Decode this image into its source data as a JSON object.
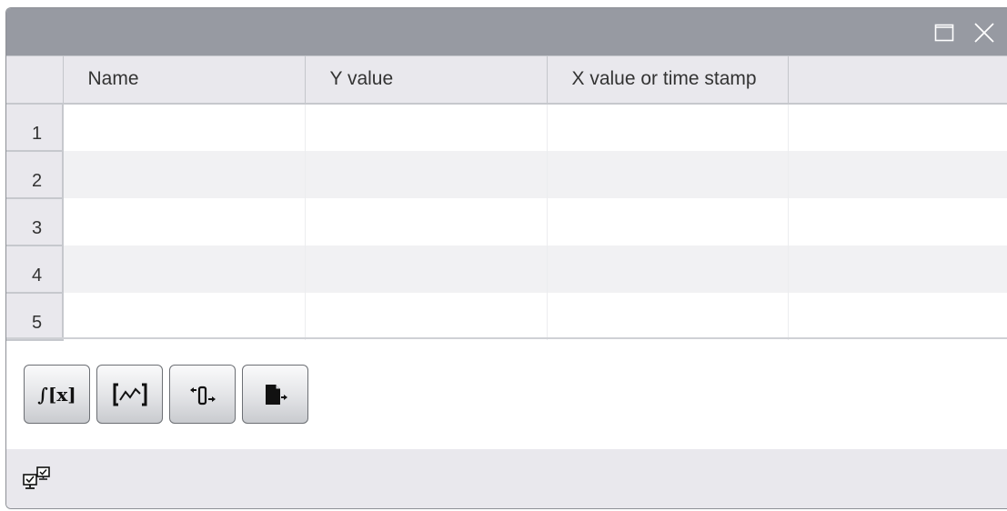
{
  "window": {
    "controls": [
      {
        "name": "maximize-icon"
      },
      {
        "name": "close-icon"
      }
    ]
  },
  "table": {
    "columns": [
      "",
      "Name",
      "Y value",
      "X value or time stamp",
      ""
    ],
    "rows": [
      {
        "num": "1",
        "name": "",
        "y": "",
        "x": ""
      },
      {
        "num": "2",
        "name": "",
        "y": "",
        "x": ""
      },
      {
        "num": "3",
        "name": "",
        "y": "",
        "x": ""
      },
      {
        "num": "4",
        "name": "",
        "y": "",
        "x": ""
      },
      {
        "num": "5",
        "name": "",
        "y": "",
        "x": ""
      }
    ]
  },
  "toolbar": {
    "buttons": [
      {
        "icon": "integral-icon",
        "glyph": "∫[x]"
      },
      {
        "icon": "trend-range-icon",
        "glyph": "[⁄\\⁄]"
      },
      {
        "icon": "ruler-move-icon",
        "glyph": ""
      },
      {
        "icon": "export-file-icon",
        "glyph": ""
      }
    ]
  },
  "statusbar": {
    "icon": "online-connection-icon"
  },
  "colors": {
    "titlebar": "#979aa2",
    "header_bg": "#e9e8ed",
    "row_alt": "#f1f1f3",
    "border": "#c6c8cd"
  }
}
